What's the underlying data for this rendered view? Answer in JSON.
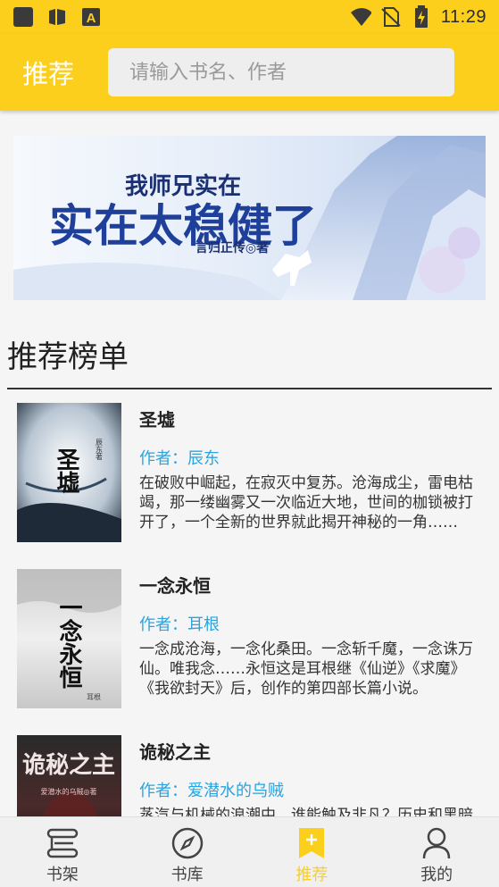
{
  "status_bar": {
    "time": "11:29",
    "icons": [
      "app-square-icon",
      "book-icon",
      "font-a-icon",
      "wifi-icon",
      "no-sim-icon",
      "battery-charging-icon"
    ]
  },
  "app_bar": {
    "title": "推荐",
    "search_placeholder": "请输入书名、作者"
  },
  "banner": {
    "title_line1": "我师兄实在",
    "title_line2": "实在太稳健了",
    "author_line": "言归正传◎著"
  },
  "section": {
    "title": "推荐榜单"
  },
  "books": [
    {
      "title": "圣墟",
      "author": "作者：辰东",
      "description": "在破败中崛起，在寂灭中复苏。沧海成尘，雷电枯竭，那一缕幽雾又一次临近大地，世间的枷锁被打开了，一个全新的世界就此揭开神秘的一角……",
      "cover_text": "圣墟",
      "cover_small": "辰东著"
    },
    {
      "title": "一念永恒",
      "author": "作者：耳根",
      "description": "一念成沧海，一念化桑田。一念斩千魔，一念诛万仙。唯我念……永恒这是耳根继《仙逆》《求魔》《我欲封天》后，创作的第四部长篇小说。",
      "cover_text": "一念永恒",
      "cover_small": "耳根"
    },
    {
      "title": "诡秘之主",
      "author": "作者：爱潜水的乌贼",
      "description": "蒸汽与机械的浪潮中，谁能触及非凡？历史和黑暗的迷雾里，又是谁在耳语？我从诡秘中醒来，睁眼看见这个世界：",
      "cover_text": "诡秘之主",
      "cover_small": "爱潜水的乌贼◎著"
    }
  ],
  "bottom_nav": [
    {
      "label": "书架",
      "icon": "bookshelf-icon",
      "active": false
    },
    {
      "label": "书库",
      "icon": "compass-icon",
      "active": false
    },
    {
      "label": "推荐",
      "icon": "bookmark-plus-icon",
      "active": true
    },
    {
      "label": "我的",
      "icon": "person-icon",
      "active": false
    }
  ],
  "colors": {
    "accent": "#fccf1c",
    "author_link": "#2aa4e0",
    "background": "#f5f5f5"
  }
}
